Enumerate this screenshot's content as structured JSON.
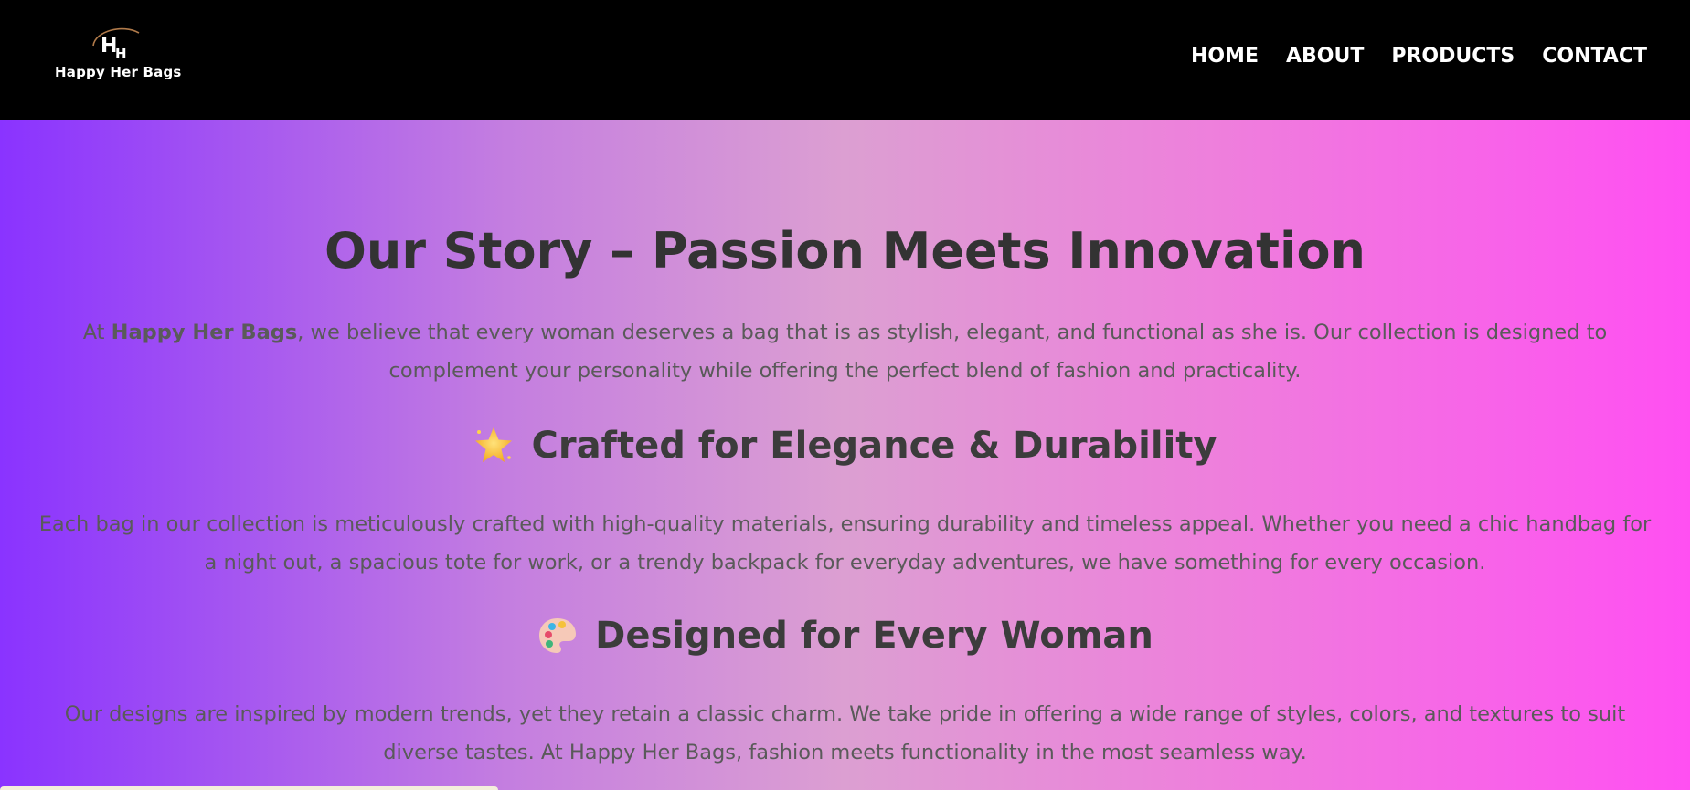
{
  "brand": {
    "logo_text": "Happy Her Bags"
  },
  "nav": {
    "items": [
      {
        "label": "HOME"
      },
      {
        "label": "ABOUT"
      },
      {
        "label": "PRODUCTS"
      },
      {
        "label": "CONTACT"
      }
    ]
  },
  "hero": {
    "title": "Our Story – Passion Meets Innovation",
    "intro_prefix": "At ",
    "intro_brand": "Happy Her Bags",
    "intro_rest": ", we believe that every woman deserves a bag that is as stylish, elegant, and functional as she is. Our collection is designed to complement your personality while offering the perfect blend of fashion and practicality.",
    "section1": {
      "icon": "star-icon",
      "heading": "Crafted for Elegance & Durability",
      "body": "Each bag in our collection is meticulously crafted with high-quality materials, ensuring durability and timeless appeal. Whether you need a chic handbag for a night out, a spacious tote for work, or a trendy backpack for everyday adventures, we have something for every occasion."
    },
    "section2": {
      "icon": "palette-icon",
      "heading": "Designed for Every Woman",
      "body": "Our designs are inspired by modern trends, yet they retain a classic charm. We take pride in offering a wide range of styles, colors, and textures to suit diverse tastes. At Happy Her Bags, fashion meets functionality in the most seamless way."
    }
  },
  "colors": {
    "nav_bg": "#000000",
    "gradient_left": "#8a33ff",
    "gradient_mid": "#dc9fd2",
    "gradient_right": "#ff4ff2"
  }
}
